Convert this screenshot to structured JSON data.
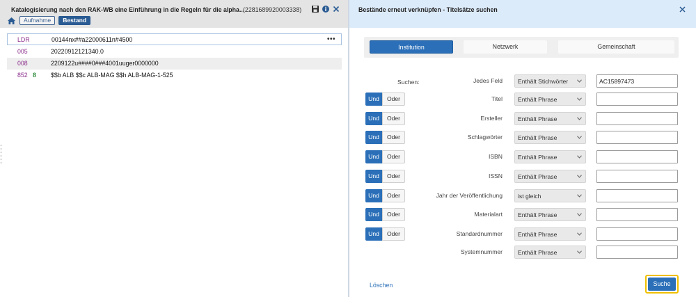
{
  "left": {
    "title": "Katalogisierung nach den RAK-WB eine Einführung in die Regeln für die alpha...",
    "record_id": "(2281689920003338)",
    "icons": {
      "save": "save-icon",
      "info": "info-icon",
      "close": "close-icon",
      "home": "home-icon"
    },
    "tabs": [
      {
        "label": "Aufnahme"
      },
      {
        "label": "Bestand"
      }
    ],
    "active_tab": "Bestand",
    "records": [
      {
        "tag": "LDR",
        "ind": "",
        "value": "00144nx##a22000611n#4500"
      },
      {
        "tag": "005",
        "ind": "",
        "value": "20220912121340.0"
      },
      {
        "tag": "008",
        "ind": "",
        "value": "2209122u####0###4001uuger0000000"
      },
      {
        "tag": "852",
        "ind": "8",
        "value": "$$b ALB $$c ALB-MAG $$h ALB-MAG-1-525"
      }
    ],
    "more_label": "•••"
  },
  "right": {
    "title": "Bestände erneut verknüpfen - Titelsätze suchen",
    "scopes": [
      {
        "label": "Institution"
      },
      {
        "label": "Netzwerk"
      },
      {
        "label": "Gemeinschaft"
      }
    ],
    "active_scope": "Institution",
    "search_label": "Suchen:",
    "bool_und": "Und",
    "bool_oder": "Oder",
    "rows": [
      {
        "field": "Jedes Feld",
        "operator": "Enthält Stichwörter",
        "value": "AC15897473"
      },
      {
        "field": "Titel",
        "operator": "Enthält Phrase",
        "value": ""
      },
      {
        "field": "Ersteller",
        "operator": "Enthält Phrase",
        "value": ""
      },
      {
        "field": "Schlagwörter",
        "operator": "Enthält Phrase",
        "value": ""
      },
      {
        "field": "ISBN",
        "operator": "Enthält Phrase",
        "value": ""
      },
      {
        "field": "ISSN",
        "operator": "Enthält Phrase",
        "value": ""
      },
      {
        "field": "Jahr der Veröffentlichung",
        "operator": "ist gleich",
        "value": ""
      },
      {
        "field": "Materialart",
        "operator": "Enthält Phrase",
        "value": ""
      },
      {
        "field": "Standardnummer",
        "operator": "Enthält Phrase",
        "value": ""
      },
      {
        "field": "Systemnummer",
        "operator": "Enthält Phrase",
        "value": ""
      }
    ],
    "clear_label": "Löschen",
    "search_button": "Suche"
  },
  "colors": {
    "primary": "#2a6fb8",
    "highlight": "#f0c000",
    "header_right": "#dcebfa",
    "tag": "#8a2c8a",
    "indicator": "#2d8b3a"
  }
}
